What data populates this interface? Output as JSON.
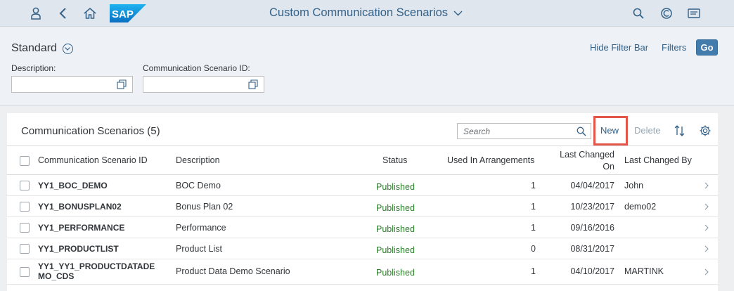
{
  "shell": {
    "title": "Custom Communication Scenarios",
    "logo_text": "SAP",
    "icons": [
      "user-icon",
      "back-icon",
      "home-icon",
      "search-icon",
      "copilot-icon",
      "notifications-icon"
    ]
  },
  "filter_bar": {
    "variant": "Standard",
    "hide_filter_bar": "Hide Filter Bar",
    "filters": "Filters",
    "go": "Go",
    "fields": [
      {
        "label": "Description:",
        "value": "",
        "placeholder": ""
      },
      {
        "label": "Communication Scenario ID:",
        "value": "",
        "placeholder": ""
      }
    ]
  },
  "table": {
    "title": "Communication Scenarios (5)",
    "search_placeholder": "Search",
    "new_label": "New",
    "delete_label": "Delete",
    "columns": {
      "id": "Communication Scenario ID",
      "description": "Description",
      "status": "Status",
      "used": "Used In Arrangements",
      "last_changed_on_1": "Last Changed",
      "last_changed_on_2": "On",
      "last_changed_by": "Last Changed By"
    },
    "rows": [
      {
        "id": "YY1_BOC_DEMO",
        "id2": "",
        "description": "BOC Demo",
        "status": "Published",
        "used": "1",
        "changed_on": "04/04/2017",
        "changed_by": "John"
      },
      {
        "id": "YY1_BONUSPLAN02",
        "id2": "",
        "description": "Bonus Plan 02",
        "status": "Published",
        "used": "1",
        "changed_on": "10/23/2017",
        "changed_by": "demo02"
      },
      {
        "id": "YY1_PERFORMANCE",
        "id2": "",
        "description": "Performance",
        "status": "Published",
        "used": "1",
        "changed_on": "09/16/2016",
        "changed_by": ""
      },
      {
        "id": "YY1_PRODUCTLIST",
        "id2": "",
        "description": "Product List",
        "status": "Published",
        "used": "0",
        "changed_on": "08/31/2017",
        "changed_by": ""
      },
      {
        "id": "YY1_YY1_PRODUCTDATADE",
        "id2": "MO_CDS",
        "description": "Product Data Demo Scenario",
        "status": "Published",
        "used": "1",
        "changed_on": "04/10/2017",
        "changed_by": "MARTINK"
      }
    ]
  },
  "colors": {
    "shell_bg": "#dfe6ed",
    "accent": "#346187",
    "go_button": "#427cac",
    "status_published": "#2b7d2b",
    "highlight_box": "#e4554a"
  }
}
